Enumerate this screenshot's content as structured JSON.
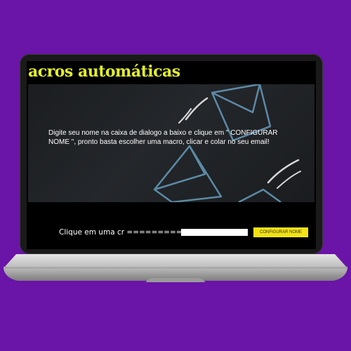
{
  "app": {
    "title": "acros automáticas"
  },
  "banner": {
    "instruction_text": "Digite seu nome na caixa de dialogo a baixo e clique em \" CONFIGURAR NOME \", pronto basta escolher uma macro, clicar e colar no seu email!"
  },
  "form": {
    "label": "Clique em uma cr =============",
    "name_value": "",
    "configure_button_label": "CONFIGURAR NOME"
  },
  "colors": {
    "background": "#6a14a8",
    "title_accent": "#e3ef2a",
    "button": "#f2e215"
  },
  "icons": [
    "envelope-icon",
    "envelope-icon",
    "envelope-icon"
  ]
}
